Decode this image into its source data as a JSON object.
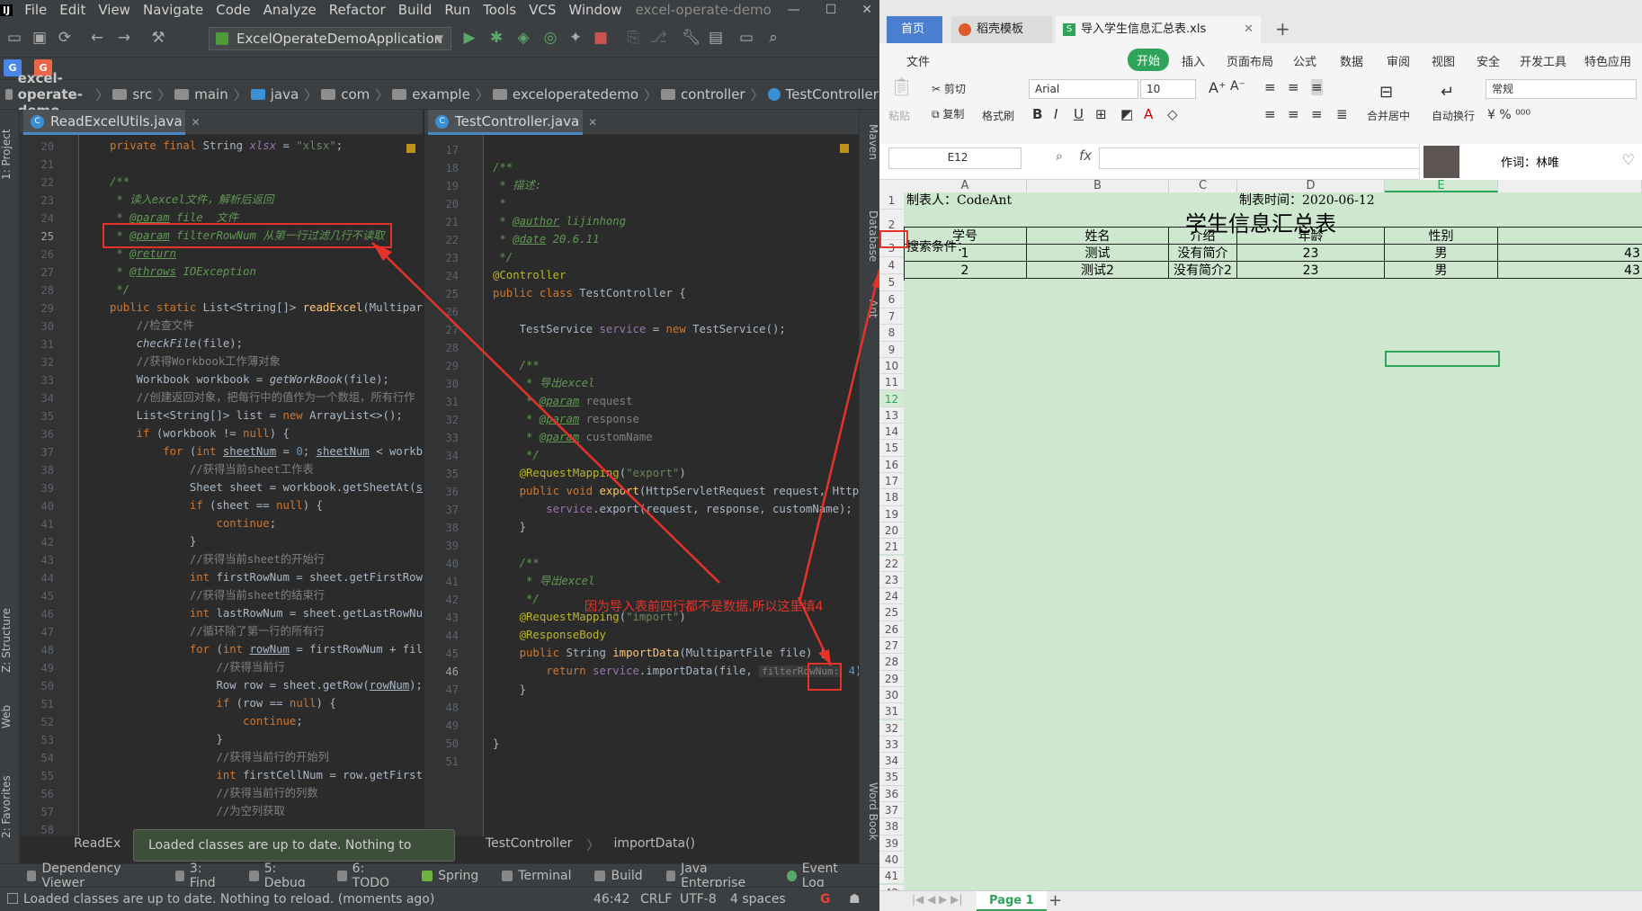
{
  "ide": {
    "menu": [
      "File",
      "Edit",
      "View",
      "Navigate",
      "Code",
      "Analyze",
      "Refactor",
      "Build",
      "Run",
      "Tools",
      "VCS",
      "Window"
    ],
    "window_title": "excel-operate-demo",
    "run_config": "ExcelOperateDemoApplication",
    "breadcrumbs": [
      "excel-operate-demo",
      "src",
      "main",
      "java",
      "com",
      "example",
      "exceloperatedemo",
      "controller",
      "TestController"
    ],
    "left_tabs": [
      "1: Project",
      "Z: Structure",
      "Web",
      "2: Favorites"
    ],
    "right_tabs": [
      "Maven",
      "Database",
      "Ant",
      "Word Book"
    ],
    "editor_left": {
      "tab": "ReadExcelUtils.java",
      "lines": [
        20,
        21,
        22,
        23,
        24,
        25,
        26,
        27,
        28,
        29,
        30,
        31,
        32,
        33,
        34,
        35,
        36,
        37,
        38,
        39,
        40,
        41,
        42,
        43,
        44,
        45,
        46,
        47,
        48,
        49,
        50,
        51,
        52,
        53,
        54,
        55,
        56,
        57,
        58
      ],
      "breadcrumb": "ReadEx"
    },
    "editor_right": {
      "tab": "TestController.java",
      "lines": [
        17,
        18,
        19,
        20,
        21,
        22,
        23,
        24,
        25,
        26,
        27,
        28,
        29,
        30,
        31,
        32,
        33,
        34,
        35,
        36,
        37,
        38,
        39,
        40,
        41,
        42,
        43,
        44,
        45,
        46,
        47,
        48,
        49,
        50,
        51
      ],
      "breadcrumb": [
        "TestController",
        "importData()"
      ]
    },
    "annotation_text": "因为导入表前四行都不是数据,所以这里填4",
    "toast": "Loaded classes are up to date. Nothing to reload.",
    "bottom_tabs": [
      "Dependency Viewer",
      "3: Find",
      "5: Debug",
      "6: TODO",
      "Spring",
      "Terminal",
      "Build",
      "Java Enterprise",
      "Event Log"
    ],
    "status": {
      "message": "Loaded classes are up to date. Nothing to reload. (moments ago)",
      "position": "46:42",
      "line_sep": "CRLF",
      "encoding": "UTF-8",
      "indent": "4 spaces"
    }
  },
  "wps": {
    "tabs": [
      "首页",
      "稻壳模板",
      "导入学生信息汇总表.xls"
    ],
    "ribbon_menu": [
      "文件",
      "开始",
      "插入",
      "页面布局",
      "公式",
      "数据",
      "审阅",
      "视图",
      "安全",
      "开发工具",
      "特色应用"
    ],
    "ribbon": {
      "cut": "剪切",
      "paste": "粘贴",
      "copy": "复制",
      "format_painter": "格式刷",
      "font": "Arial",
      "font_size": "10",
      "merge": "合并居中",
      "wrap": "自动换行",
      "number_format": "常规"
    },
    "name_box": "E12",
    "music": "作词：林唯",
    "columns": [
      "A",
      "B",
      "C",
      "D",
      "E"
    ],
    "rows": [
      1,
      2,
      3,
      4,
      5,
      6,
      7,
      8,
      9,
      10,
      11,
      12,
      13,
      14,
      15,
      16,
      17,
      18,
      19,
      20,
      21,
      22,
      23,
      24,
      25,
      26,
      27,
      28,
      29,
      30,
      31,
      32,
      33,
      34,
      35,
      36,
      37,
      38,
      39,
      40,
      41,
      42
    ],
    "sheet": {
      "maker": "制表人：CodeAnt",
      "date": "制表时间：2020-06-12",
      "title": "学生信息汇总表",
      "search": "搜索条件：",
      "headers": [
        "学号",
        "姓名",
        "介绍",
        "年龄",
        "性别"
      ],
      "data": [
        [
          "1",
          "测试",
          "没有简介",
          "23",
          "男",
          "43"
        ],
        [
          "2",
          "测试2",
          "没有简介2",
          "23",
          "男",
          "43"
        ]
      ]
    },
    "sheet_tab": "Page 1"
  }
}
